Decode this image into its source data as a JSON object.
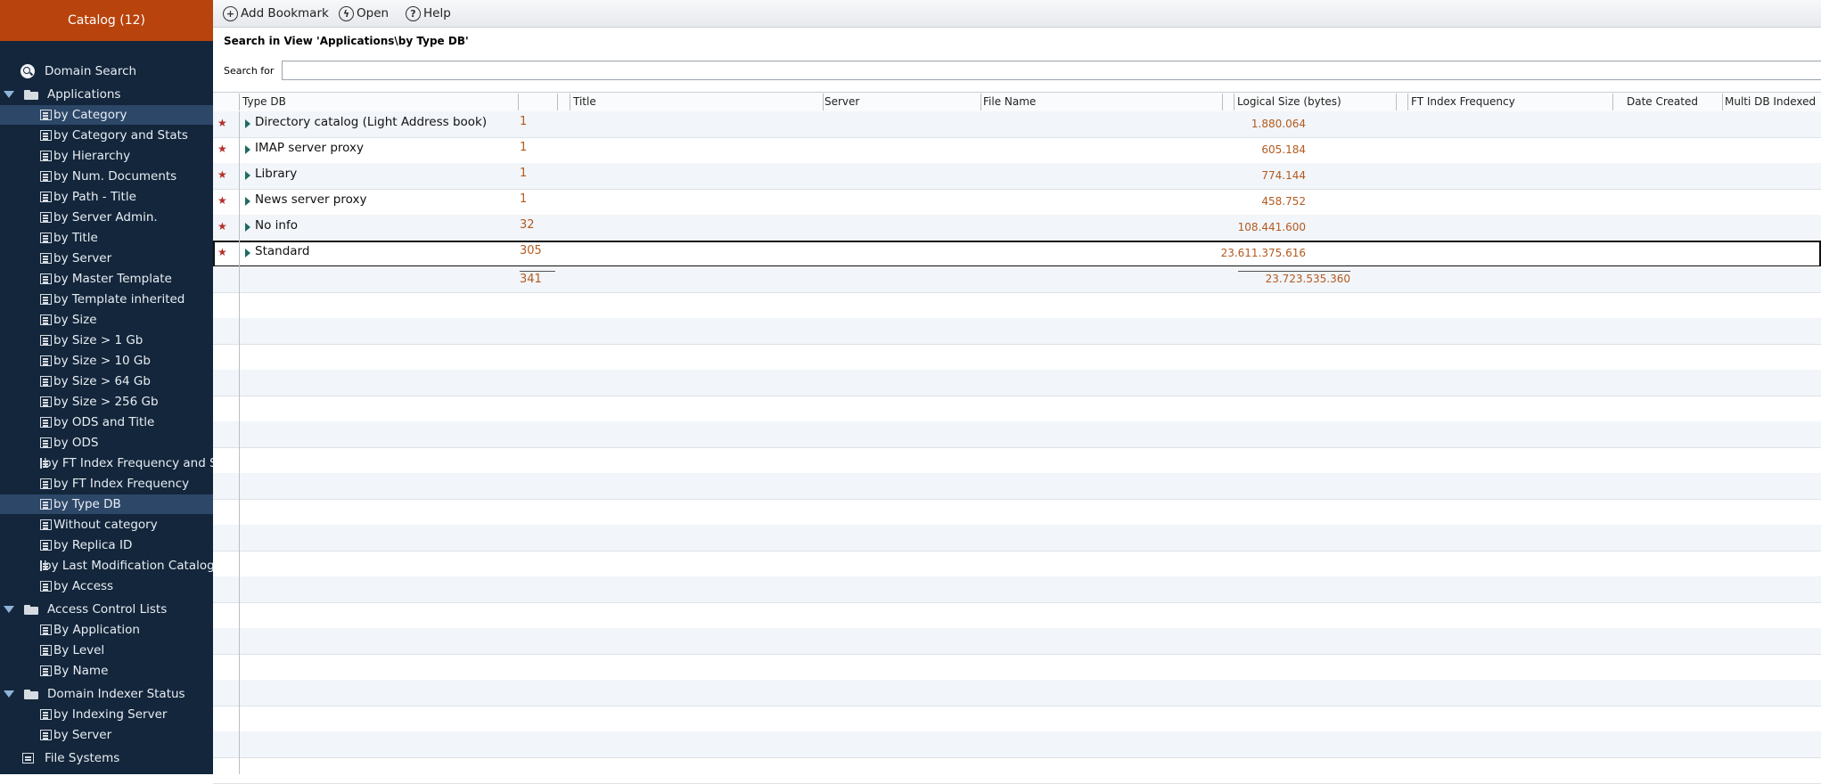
{
  "sidebar": {
    "header": "Catalog (12)",
    "domain_search": "Domain Search",
    "groups": [
      {
        "label": "Applications"
      },
      {
        "label": "Access Control Lists"
      },
      {
        "label": "Domain Indexer Status"
      }
    ],
    "applications_items": [
      "by Category",
      "by Category and Stats",
      "by Hierarchy",
      "by Num. Documents",
      "by Path - Title",
      "by Server Admin.",
      "by Title",
      "by Server",
      "by Master Template",
      "by Template inherited",
      "by Size",
      "by Size > 1 Gb",
      "by Size > 10 Gb",
      "by Size > 64 Gb",
      "by Size > 256 Gb",
      "by ODS and Title",
      "by ODS",
      "by FT Index Frequency and Size",
      "by FT Index Frequency",
      "by Type DB",
      "Without category",
      "by Replica ID",
      "by Last Modification Catalog",
      "by Access"
    ],
    "acl_items": [
      "By Application",
      "By Level",
      "By Name"
    ],
    "indexer_items": [
      "by Indexing Server",
      "by Server"
    ],
    "file_systems": "File Systems"
  },
  "toolbar": {
    "add_bookmark": "Add Bookmark",
    "open": "Open",
    "help": "Help"
  },
  "search": {
    "title": "Search in View 'Applications\\by Type DB'",
    "label": "Search for",
    "value": ""
  },
  "grid": {
    "columns": [
      "Type DB",
      "Title",
      "Server",
      "File Name",
      "Logical Size (bytes)",
      "FT Index Frequency",
      "Date Created",
      "Multi DB Indexed"
    ],
    "rows": [
      {
        "category": "Directory catalog (Light Address book)",
        "count": "1",
        "size": "1.880.064"
      },
      {
        "category": "IMAP server proxy",
        "count": "1",
        "size": "605.184"
      },
      {
        "category": "Library",
        "count": "1",
        "size": "774.144"
      },
      {
        "category": "News server proxy",
        "count": "1",
        "size": "458.752"
      },
      {
        "category": "No info",
        "count": "32",
        "size": "108.441.600"
      },
      {
        "category": "Standard",
        "count": "305",
        "size": "23.611.375.616"
      }
    ],
    "totals": {
      "count": "341",
      "size": "23.723.535.360"
    }
  },
  "colors": {
    "sidebar_bg": "#13263b",
    "header_bg": "#b9430c",
    "selected_bg": "#2d4768",
    "value_color": "#b35a1f",
    "star_color": "#b3302a"
  }
}
